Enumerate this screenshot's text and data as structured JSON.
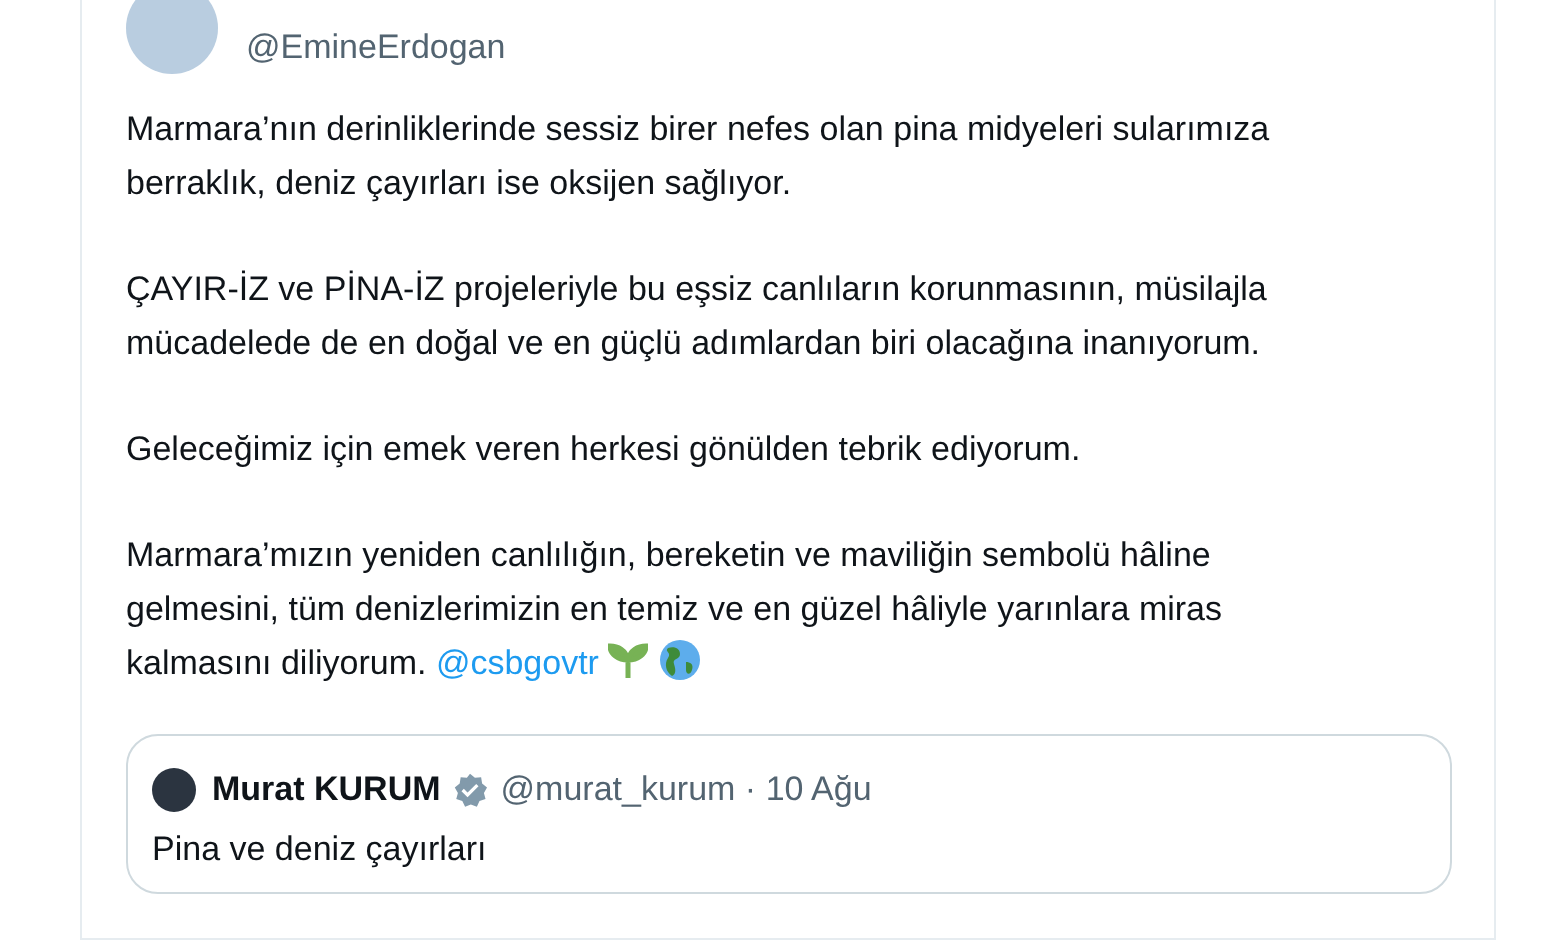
{
  "tweet": {
    "handle": "@EmineErdogan",
    "paragraphs": [
      {
        "text": "Marmara’nın derinliklerinde sessiz birer nefes olan pina midyeleri sularımıza berraklık, deniz çayırları ise oksijen sağlıyor."
      },
      {
        "text": "ÇAYIR-İZ ve PİNA-İZ projeleriyle bu eşsiz canlıların korunmasının, müsilajla mücadelede de en doğal ve en güçlü adımlardan biri olacağına inanıyorum."
      },
      {
        "text": "Geleceğimiz için emek veren herkesi gönülden tebrik ediyorum."
      },
      {
        "text": "Marmara’mızın yeniden canlılığın, bereketin ve maviliğin sembolü hâline gelmesini, tüm denizlerimizin en temiz ve en güzel hâliyle yarınlara miras kalmasını diliyorum.",
        "mention": "@csbgovtr"
      }
    ],
    "quote": {
      "name": "Murat KURUM",
      "verified": true,
      "handle": "@murat_kurum",
      "separator": "·",
      "date": "10 Ağu",
      "text": "Pina ve deniz çayırları"
    }
  }
}
